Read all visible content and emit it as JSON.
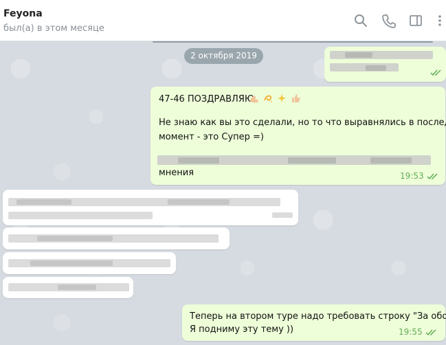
{
  "header": {
    "contact_name": "Feyona",
    "contact_status": "был(а) в этом месяце",
    "icons": [
      "search-icon",
      "phone-icon",
      "sidebar-toggle-icon",
      "more-vertical-icon"
    ]
  },
  "date_separator": "2 октября 2019",
  "messages": [
    {
      "direction": "outgoing",
      "line1": "47-46 ПОЗДРАВЛЯЮ",
      "emoji": [
        "flexed-biceps-emoji",
        "dizzy-emoji",
        "sparkles-emoji",
        "thumbs-up-emoji"
      ],
      "line2": "Не знаю как вы это сделали, но то что выравнялись в последний",
      "line3": "момент - это Супер =)",
      "line4_tail": "мнения",
      "time": "19:53",
      "status": "read"
    },
    {
      "direction": "outgoing",
      "line1": "Теперь на втором туре надо требовать строку \"За обоих\"",
      "line2": "Я подниму эту тему ))",
      "time": "19:55",
      "status": "read"
    }
  ],
  "colors": {
    "outgoing_bubble": "#eefed9",
    "incoming_bubble": "#ffffff",
    "time_green": "#62ac55",
    "date_pill": "#9aa6ad",
    "chat_background": "#d5dbe0"
  }
}
